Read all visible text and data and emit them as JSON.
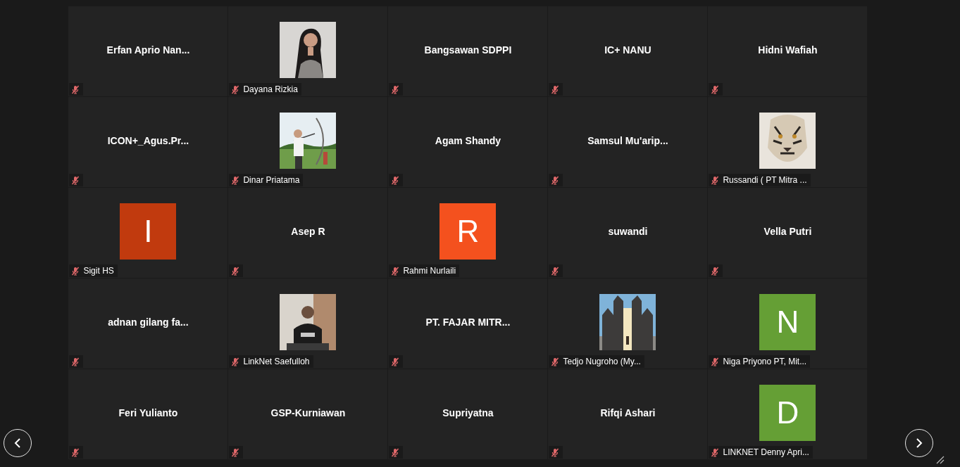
{
  "tiles": [
    {
      "kind": "name",
      "name": "Erfan Aprio Nan...",
      "muted": true
    },
    {
      "name": "Dayana Rizkia",
      "muted": true
    },
    {
      "kind": "name",
      "name": "Bangsawan SDPPI",
      "muted": true
    },
    {
      "kind": "name",
      "name": "IC+ NANU",
      "muted": true
    },
    {
      "kind": "name",
      "name": "Hidni Wafiah",
      "muted": true
    },
    {
      "kind": "name",
      "name": "ICON+_Agus.Pr...",
      "muted": true
    },
    {
      "name": "Dinar Priatama",
      "muted": true
    },
    {
      "kind": "name",
      "name": "Agam Shandy",
      "muted": true
    },
    {
      "kind": "name",
      "name": "Samsul Mu'arip...",
      "muted": true
    },
    {
      "name": "Russandi ( PT Mitra ...",
      "muted": true
    },
    {
      "kind": "avatar",
      "initial": "I",
      "color": "#c13a0e",
      "name": "Sigit HS",
      "muted": true
    },
    {
      "kind": "name",
      "name": "Asep R",
      "muted": true
    },
    {
      "kind": "avatar",
      "initial": "R",
      "color": "#f4511e",
      "name": "Rahmi Nurlaili",
      "muted": true
    },
    {
      "kind": "name",
      "name": "suwandi",
      "muted": true
    },
    {
      "kind": "name",
      "name": "Vella Putri",
      "muted": true
    },
    {
      "kind": "name",
      "name": "adnan gilang fa...",
      "muted": true
    },
    {
      "name": "LinkNet Saefulloh",
      "muted": true
    },
    {
      "kind": "name",
      "name": "PT. FAJAR MITR...",
      "muted": true
    },
    {
      "name": "Tedjo Nugroho (My...",
      "muted": true
    },
    {
      "kind": "avatar",
      "initial": "N",
      "color": "#659f35",
      "name": "Niga Priyono PT, Mit...",
      "muted": true
    },
    {
      "kind": "name",
      "name": "Feri Yulianto",
      "muted": true
    },
    {
      "kind": "name",
      "name": "GSP-Kurniawan",
      "muted": true
    },
    {
      "kind": "name",
      "name": "Supriyatna",
      "muted": true
    },
    {
      "kind": "name",
      "name": "Rifqi Ashari",
      "muted": true
    },
    {
      "kind": "avatar",
      "initial": "D",
      "color": "#659f35",
      "name": "LINKNET Denny Apri...",
      "muted": true
    }
  ]
}
